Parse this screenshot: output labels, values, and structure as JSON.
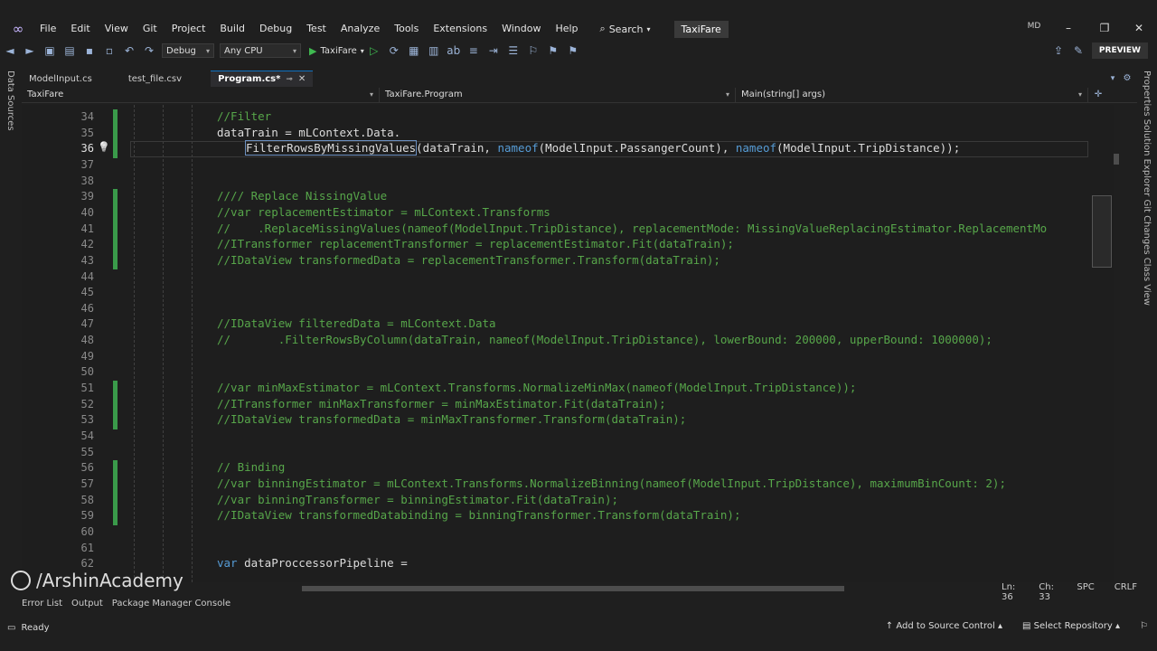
{
  "menu": [
    "File",
    "Edit",
    "View",
    "Git",
    "Project",
    "Build",
    "Debug",
    "Test",
    "Analyze",
    "Tools",
    "Extensions",
    "Window",
    "Help"
  ],
  "search_label": "Search",
  "solution_name": "TaxiFare",
  "user_initials": "MD",
  "toolbar": {
    "config": "Debug",
    "platform": "Any CPU",
    "run_target": "TaxiFare",
    "preview": "PREVIEW"
  },
  "left_panel": "Data Sources",
  "right_panel": "Properties  Solution Explorer  Git Changes  Class View",
  "tabs": [
    {
      "label": "ModelInput.cs",
      "active": false
    },
    {
      "label": "test_file.csv",
      "active": false
    },
    {
      "label": "Program.cs*",
      "active": true
    }
  ],
  "nav": {
    "project": "TaxiFare",
    "class": "TaxiFare.Program",
    "member": "Main(string[] args)"
  },
  "lines": [
    {
      "n": "34",
      "t": "//Filter",
      "c": "comment",
      "i": 0
    },
    {
      "n": "35",
      "t": "dataTrain = mLContext.Data.",
      "c": "plain",
      "i": 0
    },
    {
      "n": "36",
      "t": "FilterRowsByMissingValues(dataTrain, nameof(ModelInput.PassangerCount), nameof(ModelInput.TripDistance));",
      "c": "mixed",
      "i": 4
    },
    {
      "n": "37",
      "t": "",
      "c": "plain",
      "i": 0
    },
    {
      "n": "38",
      "t": "",
      "c": "plain",
      "i": 0
    },
    {
      "n": "39",
      "t": "//// Replace NissingValue",
      "c": "comment",
      "i": 0
    },
    {
      "n": "40",
      "t": "//var replacementEstimator = mLContext.Transforms",
      "c": "comment",
      "i": 0
    },
    {
      "n": "41",
      "t": "//    .ReplaceMissingValues(nameof(ModelInput.TripDistance), replacementMode: MissingValueReplacingEstimator.ReplacementMo",
      "c": "comment",
      "i": 0
    },
    {
      "n": "42",
      "t": "//ITransformer replacementTransformer = replacementEstimator.Fit(dataTrain);",
      "c": "comment",
      "i": 0
    },
    {
      "n": "43",
      "t": "//IDataView transformedData = replacementTransformer.Transform(dataTrain);",
      "c": "comment",
      "i": 0
    },
    {
      "n": "44",
      "t": "",
      "c": "plain",
      "i": 0
    },
    {
      "n": "45",
      "t": "",
      "c": "plain",
      "i": 0
    },
    {
      "n": "46",
      "t": "",
      "c": "plain",
      "i": 0
    },
    {
      "n": "47",
      "t": "//IDataView filteredData = mLContext.Data",
      "c": "comment",
      "i": 0
    },
    {
      "n": "48",
      "t": "//       .FilterRowsByColumn(dataTrain, nameof(ModelInput.TripDistance), lowerBound: 200000, upperBound: 1000000);",
      "c": "comment",
      "i": 0
    },
    {
      "n": "49",
      "t": "",
      "c": "plain",
      "i": 0
    },
    {
      "n": "50",
      "t": "",
      "c": "plain",
      "i": 0
    },
    {
      "n": "51",
      "t": "//var minMaxEstimator = mLContext.Transforms.NormalizeMinMax(nameof(ModelInput.TripDistance));",
      "c": "comment",
      "i": 0
    },
    {
      "n": "52",
      "t": "//ITransformer minMaxTransformer = minMaxEstimator.Fit(dataTrain);",
      "c": "comment",
      "i": 0
    },
    {
      "n": "53",
      "t": "//IDataView transformedData = minMaxTransformer.Transform(dataTrain);",
      "c": "comment",
      "i": 0
    },
    {
      "n": "54",
      "t": "",
      "c": "plain",
      "i": 0
    },
    {
      "n": "55",
      "t": "",
      "c": "plain",
      "i": 0
    },
    {
      "n": "56",
      "t": "// Binding",
      "c": "comment",
      "i": 0
    },
    {
      "n": "57",
      "t": "//var binningEstimator = mLContext.Transforms.NormalizeBinning(nameof(ModelInput.TripDistance), maximumBinCount: 2);",
      "c": "comment",
      "i": 0
    },
    {
      "n": "58",
      "t": "//var binningTransformer = binningEstimator.Fit(dataTrain);",
      "c": "comment",
      "i": 0
    },
    {
      "n": "59",
      "t": "//IDataView transformedDatabinding = binningTransformer.Transform(dataTrain);",
      "c": "comment",
      "i": 0
    },
    {
      "n": "60",
      "t": "",
      "c": "plain",
      "i": 0
    },
    {
      "n": "61",
      "t": "",
      "c": "plain",
      "i": 0
    },
    {
      "n": "62",
      "t": "var dataProccessorPipeline =",
      "c": "var",
      "i": 0
    }
  ],
  "current_line": "36",
  "position": {
    "line": "Ln: 36",
    "col": "Ch: 33",
    "spc": "SPC",
    "eol": "CRLF"
  },
  "bottom_tabs": [
    "Error List",
    "Output",
    "Package Manager Console"
  ],
  "status": {
    "ready": "Ready",
    "source_control": "Add to Source Control",
    "repo": "Select Repository"
  },
  "watermark": "/ArshinAcademy",
  "colors": {
    "comment": "#57a64a",
    "keyword": "#569cd6",
    "change_bar": "#3a9a4a"
  }
}
